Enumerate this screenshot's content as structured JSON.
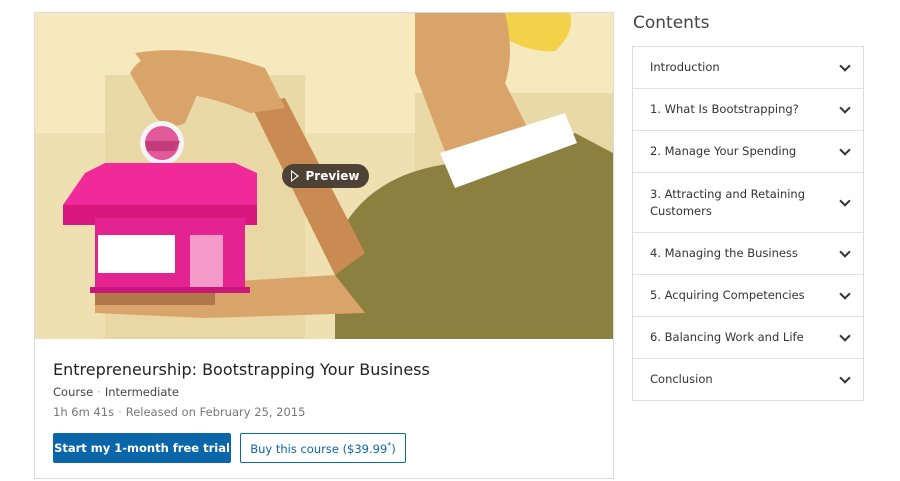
{
  "course": {
    "preview_label": "Preview",
    "title": "Entrepreneurship: Bootstrapping Your Business",
    "type": "Course",
    "level": "Intermediate",
    "duration": "1h 6m 41s",
    "released": "Released on February 25, 2015",
    "trial_button": "Start my 1-month free trial",
    "buy_button": "Buy this course ($39.99",
    "buy_button_sup": "*",
    "buy_button_close": ")"
  },
  "contents": {
    "heading": "Contents",
    "items": [
      {
        "label": "Introduction"
      },
      {
        "label": "1. What Is Bootstrapping?"
      },
      {
        "label": "2. Manage Your Spending"
      },
      {
        "label": "3. Attracting and Retaining Customers"
      },
      {
        "label": "4. Managing the Business"
      },
      {
        "label": "5. Acquiring Competencies"
      },
      {
        "label": "6. Balancing Work and Life"
      },
      {
        "label": "Conclusion"
      }
    ]
  },
  "colors": {
    "accent_blue": "#0a66a8",
    "hero_background": "#f5e9bd",
    "house_pink": "#e8208f",
    "shirt_olive": "#8c8040"
  }
}
